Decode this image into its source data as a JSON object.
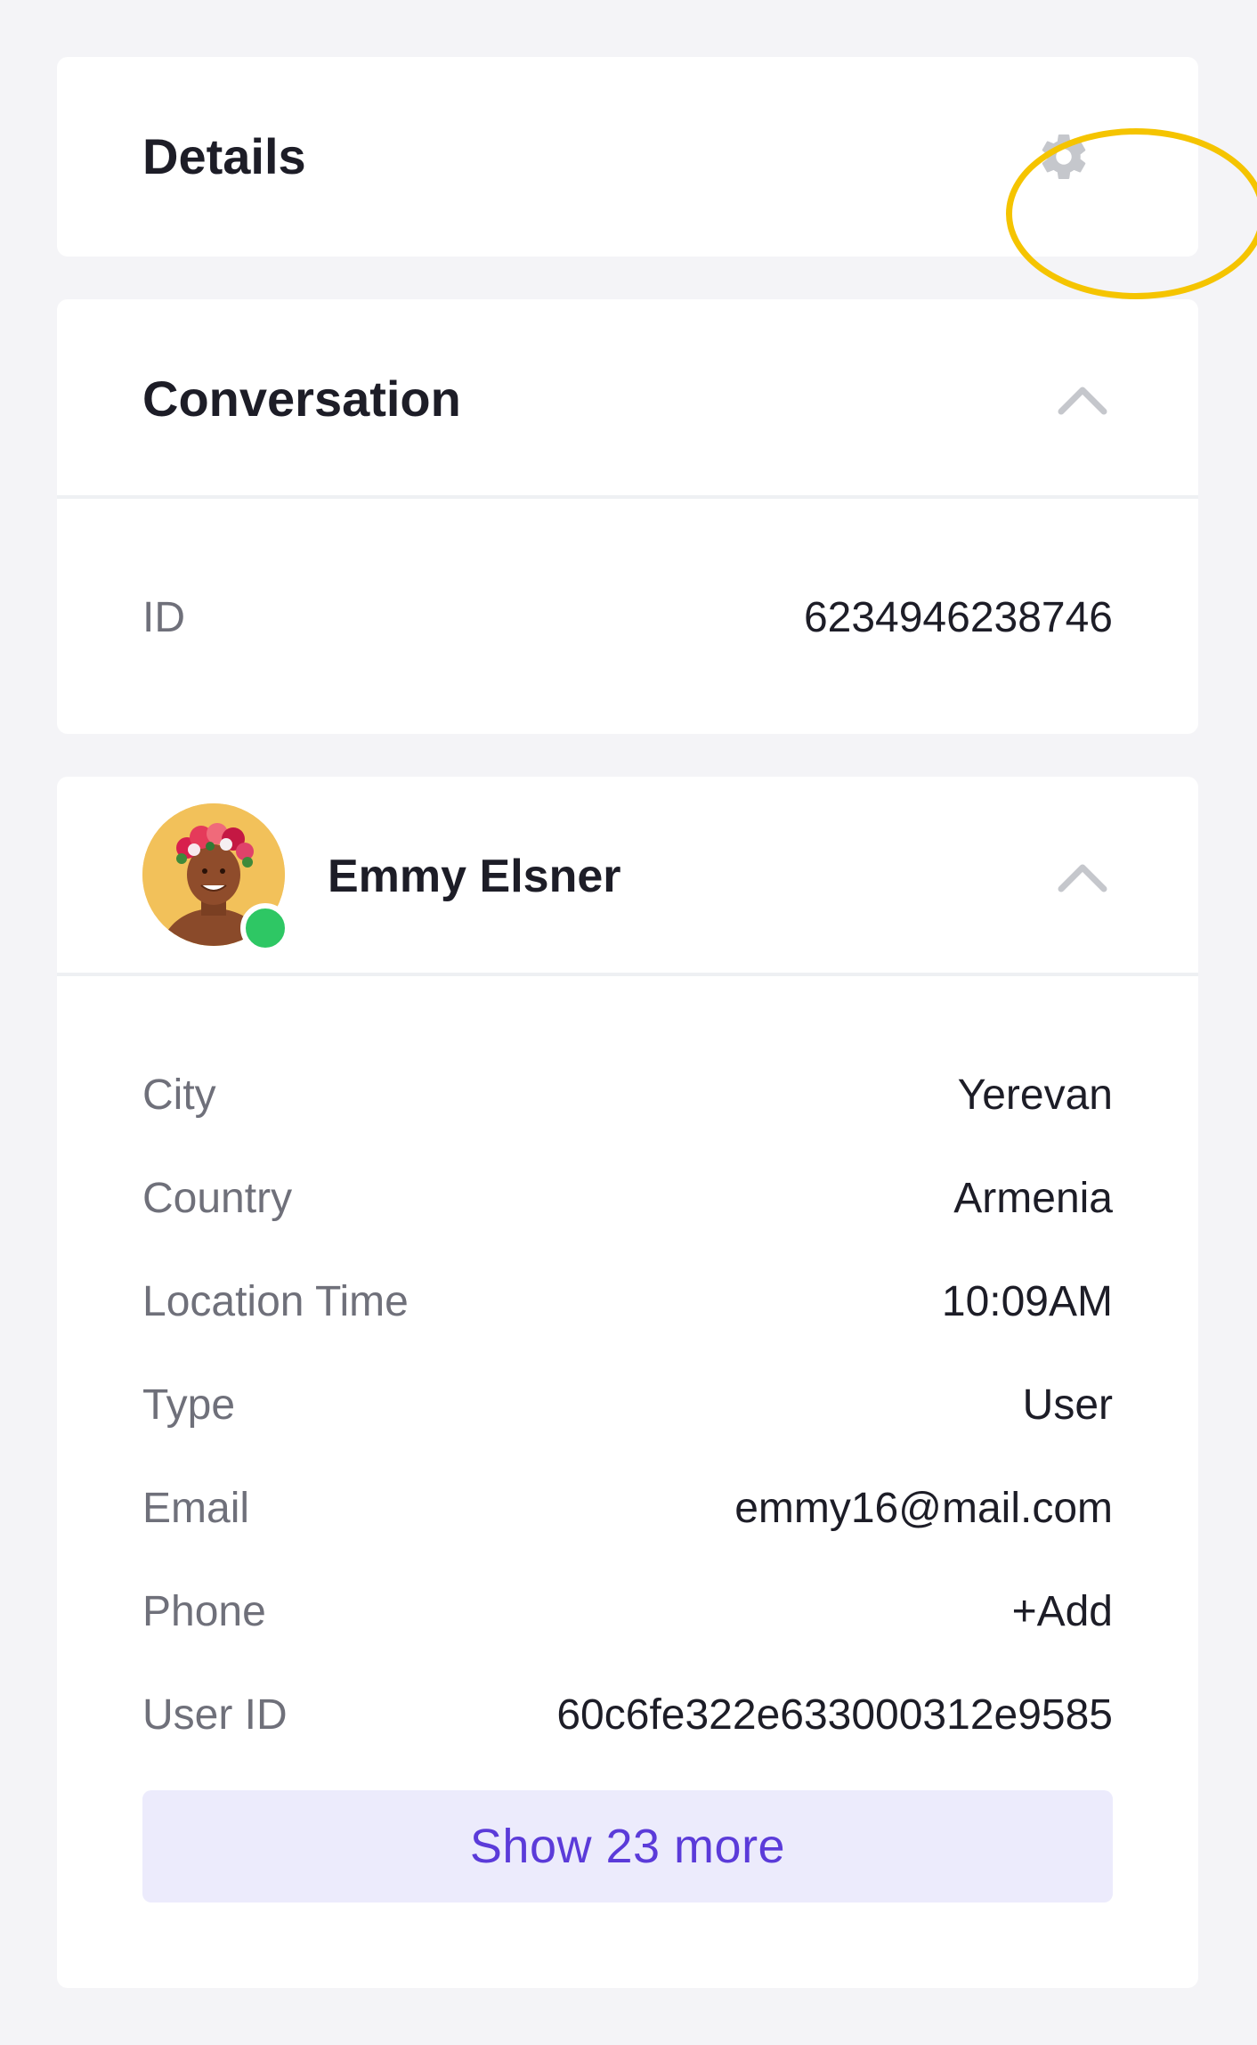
{
  "details": {
    "title": "Details",
    "settings_icon": "gear-icon"
  },
  "conversation": {
    "title": "Conversation",
    "collapse_icon": "chevron-up-icon",
    "rows": [
      {
        "label": "ID",
        "value": "6234946238746"
      }
    ]
  },
  "contact": {
    "name": "Emmy Elsner",
    "avatar": "avatar-photo",
    "presence": "online",
    "collapse_icon": "chevron-up-icon",
    "rows": [
      {
        "label": "City",
        "value": "Yerevan"
      },
      {
        "label": "Country",
        "value": "Armenia"
      },
      {
        "label": "Location Time",
        "value": "10:09AM"
      },
      {
        "label": "Type",
        "value": "User"
      },
      {
        "label": "Email",
        "value": "emmy16@mail.com"
      },
      {
        "label": "Phone",
        "value": "+Add"
      },
      {
        "label": "User ID",
        "value": "60c6fe322e633000312e9585"
      }
    ],
    "show_more_label": "Show 23 more"
  },
  "colors": {
    "background": "#f4f4f7",
    "card": "#ffffff",
    "highlight_ring": "#f5c400",
    "presence_online": "#2ec764",
    "accent_text": "#5b3bd9",
    "accent_bg": "#ecebfc"
  }
}
